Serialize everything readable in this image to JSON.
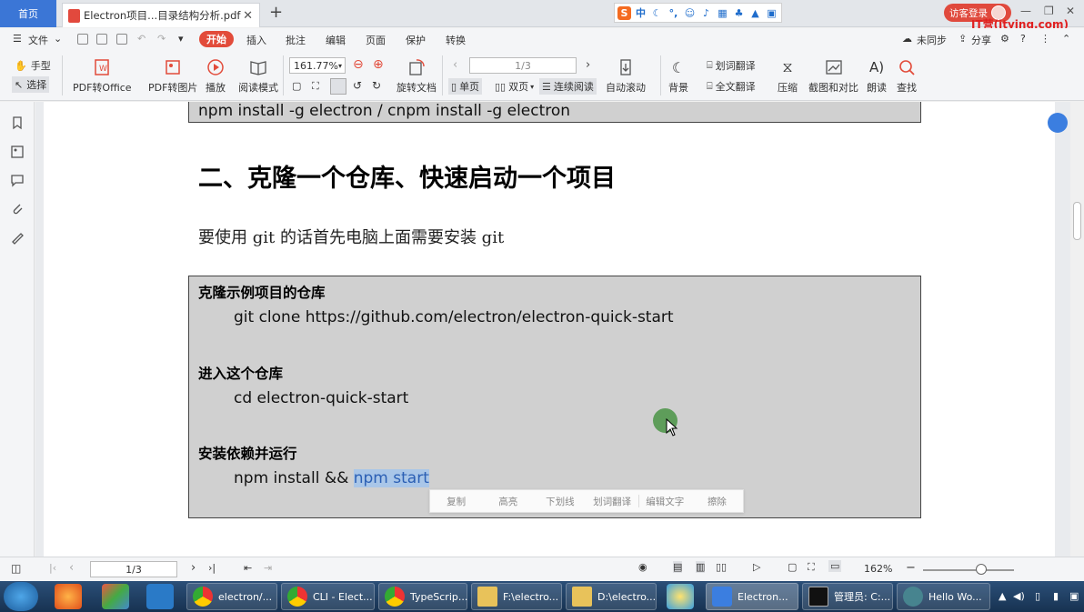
{
  "titlebar": {
    "home_tab": "首页",
    "doc_tab": "Electron项目...目录结构分析.pdf",
    "add_tab": "+",
    "close_tab": "✕",
    "visitor_login": "访客登录",
    "watermark": "IT营(itying.com)"
  },
  "menu": {
    "file": "文件",
    "start": "开始",
    "insert": "插入",
    "annotate": "批注",
    "edit": "编辑",
    "page": "页面",
    "protect": "保护",
    "convert": "转换",
    "sync": "未同步",
    "share": "分享"
  },
  "toolbar": {
    "hand": "手型",
    "select": "选择",
    "pdf_to_office": "PDF转Office",
    "pdf_to_image": "PDF转图片",
    "play": "播放",
    "read_mode": "阅读模式",
    "zoom_value": "161.77%",
    "rotate_doc": "旋转文档",
    "page_value": "1/3",
    "single_page": "单页",
    "double_page": "双页",
    "continuous": "连续阅读",
    "auto_scroll": "自动滚动",
    "background": "背景",
    "word_translate": "划词翻译",
    "full_translate": "全文翻译",
    "compress": "压缩",
    "screenshot_compare": "截图和对比",
    "read_aloud": "朗读",
    "find": "查找"
  },
  "document": {
    "code_top": "npm install -g electron   / cnpm install -g electron",
    "heading": "二、克隆一个仓库、快速启动一个项目",
    "paragraph": "要使用 git 的话首先电脑上面需要安装 git",
    "block": {
      "h1": "克隆示例项目的仓库",
      "c1": "git clone https://github.com/electron/electron-quick-start",
      "h2": "进入这个仓库",
      "c2": "cd electron-quick-start",
      "h3": "安装依赖并运行",
      "c3_plain": "npm install && ",
      "c3_selected": "npm start"
    },
    "selection_menu": {
      "copy": "复制",
      "highlight": "高亮",
      "underline": "下划线",
      "translate": "划词翻译",
      "edit_text": "编辑文字",
      "erase": "擦除"
    }
  },
  "statusbar": {
    "page_value": "1/3",
    "zoom_value": "162%"
  },
  "taskbar": {
    "tasks": [
      "electron/...",
      "CLI - Elect...",
      "TypeScrip...",
      "F:\\electro...",
      "D:\\electro...",
      "Electron...",
      "管理员: C:...",
      "Hello Wo..."
    ]
  },
  "colors": {
    "accent_red": "#e24b3a",
    "home_tab_blue": "#3b76d6",
    "code_bg": "#d0d0d0",
    "selection": "#a9c6e8"
  }
}
